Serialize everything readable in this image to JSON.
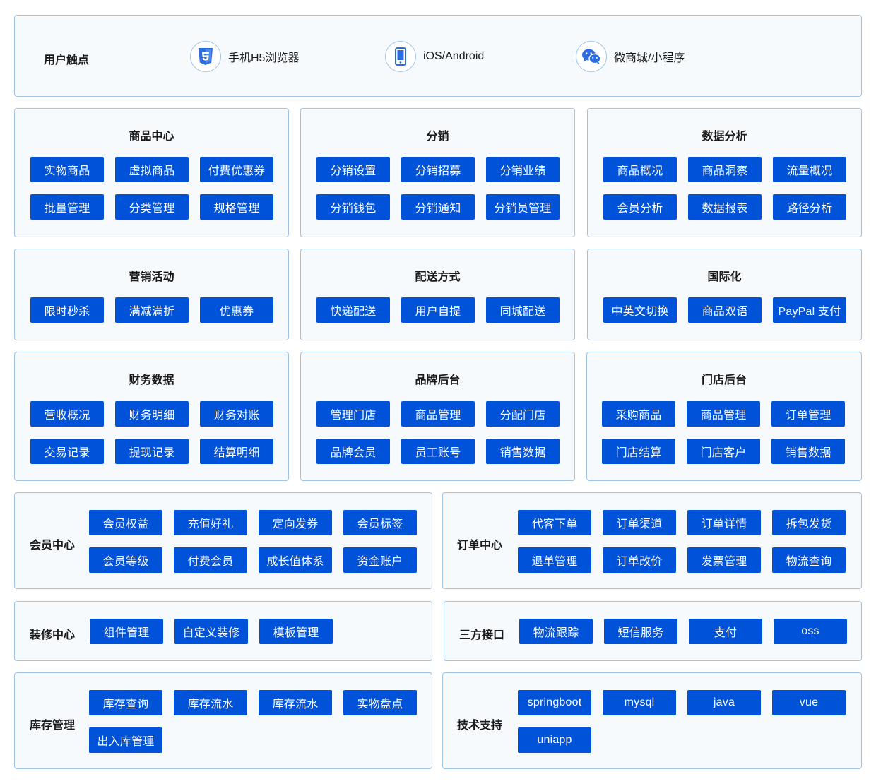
{
  "touchpoints": {
    "title": "用户触点",
    "items": [
      {
        "label": "手机H5浏览器",
        "icon": "html5-icon"
      },
      {
        "label": "iOS/Android",
        "icon": "phone-icon"
      },
      {
        "label": "微商城/小程序",
        "icon": "wechat-icon"
      }
    ]
  },
  "colors": {
    "chip": "#0052d9",
    "border": "#9dc3e6",
    "panel_bg": "#f7fafd"
  },
  "modules": {
    "product": {
      "title": "商品中心",
      "items": [
        "实物商品",
        "虚拟商品",
        "付费优惠券",
        "批量管理",
        "分类管理",
        "规格管理"
      ]
    },
    "distribution": {
      "title": "分销",
      "items": [
        "分销设置",
        "分销招募",
        "分销业绩",
        "分销钱包",
        "分销通知",
        "分销员管理"
      ]
    },
    "analytics": {
      "title": "数据分析",
      "items": [
        "商品概况",
        "商品洞察",
        "流量概况",
        "会员分析",
        "数据报表",
        "路径分析"
      ]
    },
    "marketing": {
      "title": "营销活动",
      "items": [
        "限时秒杀",
        "满减满折",
        "优惠券"
      ]
    },
    "delivery": {
      "title": "配送方式",
      "items": [
        "快递配送",
        "用户自提",
        "同城配送"
      ]
    },
    "i18n": {
      "title": "国际化",
      "items": [
        "中英文切换",
        "商品双语",
        "PayPal 支付"
      ]
    },
    "finance": {
      "title": "财务数据",
      "items": [
        "营收概况",
        "财务明细",
        "财务对账",
        "交易记录",
        "提现记录",
        "结算明细"
      ]
    },
    "brand": {
      "title": "品牌后台",
      "items": [
        "管理门店",
        "商品管理",
        "分配门店",
        "品牌会员",
        "员工账号",
        "销售数据"
      ]
    },
    "store": {
      "title": "门店后台",
      "items": [
        "采购商品",
        "商品管理",
        "订单管理",
        "门店结算",
        "门店客户",
        "销售数据"
      ]
    },
    "member": {
      "title": "会员中心",
      "items": [
        "会员权益",
        "充值好礼",
        "定向发券",
        "会员标签",
        "会员等级",
        "付费会员",
        "成长值体系",
        "资金账户"
      ]
    },
    "order": {
      "title": "订单中心",
      "items": [
        "代客下单",
        "订单渠道",
        "订单详情",
        "拆包发货",
        "退单管理",
        "订单改价",
        "发票管理",
        "物流查询"
      ]
    },
    "decoration": {
      "title": "装修中心",
      "items": [
        "组件管理",
        "自定义装修",
        "模板管理"
      ]
    },
    "thirdparty": {
      "title": "三方接口",
      "items": [
        "物流跟踪",
        "短信服务",
        "支付",
        "oss"
      ]
    },
    "inventory": {
      "title": "库存管理",
      "items": [
        "库存查询",
        "库存流水",
        "库存流水",
        "实物盘点",
        "出入库管理"
      ]
    },
    "tech": {
      "title": "技术支持",
      "items": [
        "springboot",
        "mysql",
        "java",
        "vue",
        "uniapp"
      ]
    }
  }
}
